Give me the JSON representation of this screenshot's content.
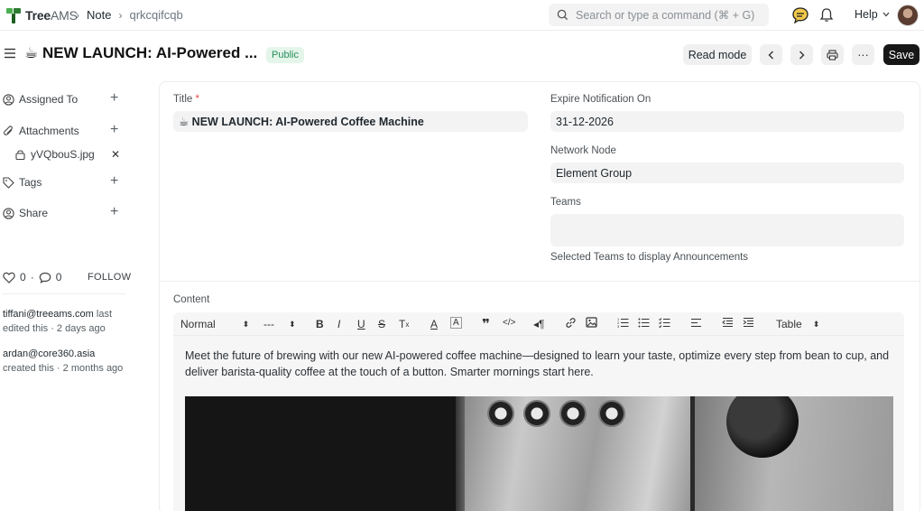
{
  "app": {
    "logo_text": "Tree",
    "logo_text_suffix": "AMS"
  },
  "breadcrumb": {
    "items": [
      "Note",
      "qrkcqifcqb"
    ]
  },
  "search": {
    "placeholder": "Search or type a command (⌘ + G)"
  },
  "header": {
    "help_label": "Help"
  },
  "page": {
    "title": "☕ NEW LAUNCH: AI-Powered ...",
    "status_badge": "Public",
    "read_mode_label": "Read mode",
    "more_label": "···",
    "save_label": "Save"
  },
  "sidebar": {
    "assigned_to": "Assigned To",
    "attachments": "Attachments",
    "attachment_file": "yVQbouS.jpg",
    "tags": "Tags",
    "share": "Share",
    "likes_count": "0",
    "comments_count": "0",
    "follow_label": "FOLLOW",
    "activity": [
      {
        "user": "tiffani@treeams.com",
        "text": " last edited this · 2 days ago"
      },
      {
        "user": "ardan@core360.asia",
        "text": " created this · 2 months ago"
      }
    ]
  },
  "form": {
    "title_label": "Title",
    "title_required": "*",
    "title_value": "☕ NEW LAUNCH: AI-Powered Coffee Machine",
    "expire_label": "Expire Notification On",
    "expire_value": "31-12-2026",
    "network_node_label": "Network Node",
    "network_node_value": "Element Group",
    "teams_label": "Teams",
    "teams_value": "",
    "teams_hint": "Selected Teams to display Announcements",
    "content_label": "Content"
  },
  "editor": {
    "paragraph_style": "Normal",
    "font_size": "---",
    "table_label": "Table",
    "body_text": "Meet the future of brewing with our new AI-powered coffee machine—designed to learn your taste, optimize every step from bean to cup, and deliver barista-quality coffee at the touch of a button. Smarter mornings start here."
  },
  "colors": {
    "accent_green": "#278f5e",
    "badge_bg": "#e4f5e9",
    "save_bg": "#171717"
  }
}
